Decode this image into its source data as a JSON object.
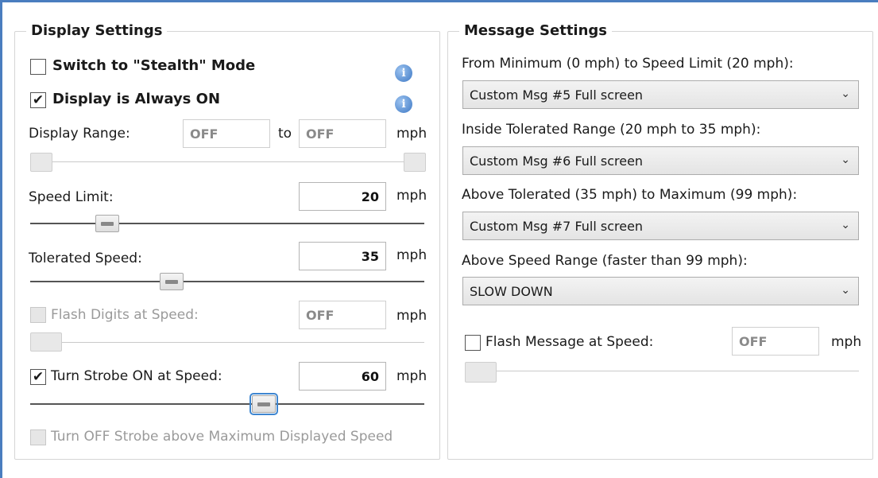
{
  "display_settings": {
    "title": "Display Settings",
    "stealth_label": "Switch to \"Stealth\" Mode",
    "stealth_checked": "",
    "always_on_label": "Display is Always ON",
    "always_on_checked": "✔",
    "info_icon": "i",
    "range_label": "Display Range:",
    "range_from": "OFF",
    "range_to_word": "to",
    "range_to": "OFF",
    "unit": "mph",
    "speed_limit_label": "Speed Limit:",
    "speed_limit_value": "20",
    "tolerated_label": "Tolerated Speed:",
    "tolerated_value": "35",
    "flash_digits_label": "Flash Digits at Speed:",
    "flash_digits_value": "OFF",
    "strobe_label": "Turn Strobe ON at Speed:",
    "strobe_checked": "✔",
    "strobe_value": "60",
    "strobe_off_label": "Turn OFF Strobe above Maximum Displayed Speed"
  },
  "message_settings": {
    "title": "Message Settings",
    "rows": [
      {
        "label": "From Minimum (0 mph) to Speed Limit (20 mph):",
        "value": "Custom Msg #5 Full screen"
      },
      {
        "label": "Inside Tolerated Range (20 mph to 35 mph):",
        "value": "Custom Msg #6 Full screen"
      },
      {
        "label": "Above Tolerated (35 mph) to Maximum (99 mph):",
        "value": "Custom Msg #7 Full screen"
      },
      {
        "label": "Above Speed Range (faster than 99 mph):",
        "value": "SLOW DOWN"
      }
    ],
    "flash_message_label": "Flash Message at Speed:",
    "flash_message_value": "OFF",
    "unit": "mph",
    "chevron": "⌄"
  }
}
